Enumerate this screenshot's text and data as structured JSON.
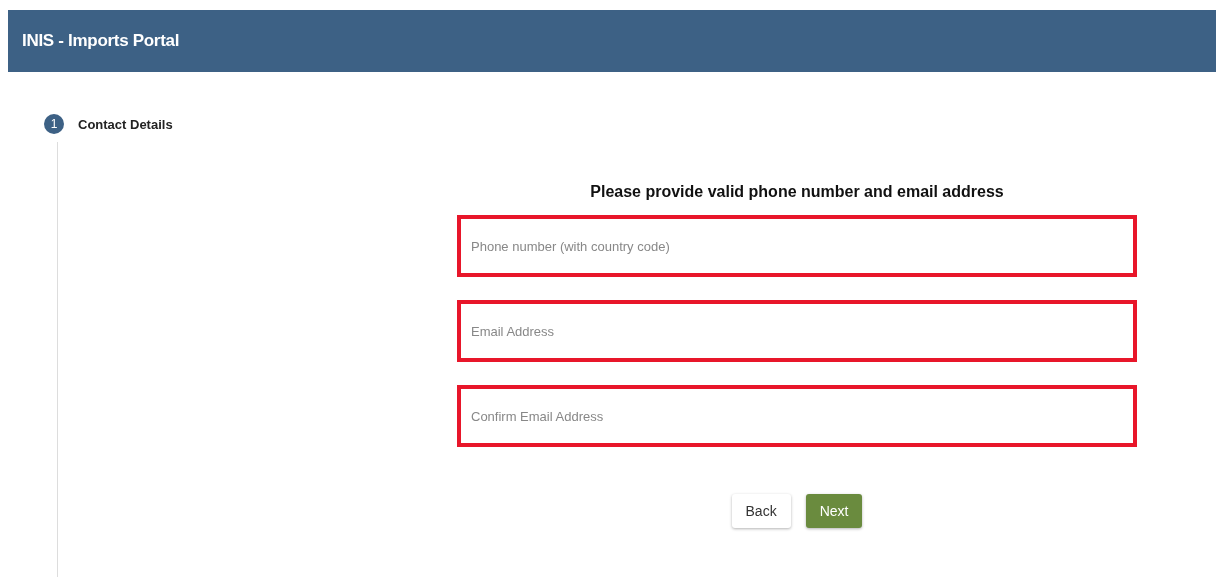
{
  "header": {
    "title": "INIS - Imports Portal"
  },
  "stepper": {
    "steps": [
      {
        "number": "1",
        "label": "Contact Details",
        "selected": true
      }
    ]
  },
  "form": {
    "heading": "Please provide valid phone number and email address",
    "fields": [
      {
        "placeholder": "Phone number (with country code)",
        "highlighted": true
      },
      {
        "placeholder": "Email Address",
        "highlighted": true
      },
      {
        "placeholder": "Confirm Email Address",
        "highlighted": true
      }
    ],
    "buttons": [
      {
        "label": "Back",
        "kind": "secondary"
      },
      {
        "label": "Next",
        "kind": "primary"
      }
    ]
  }
}
